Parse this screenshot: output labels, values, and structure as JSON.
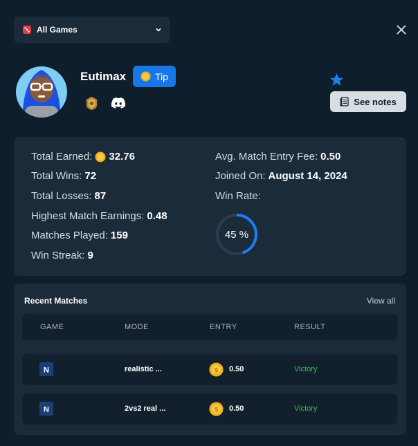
{
  "game_selector": {
    "label": "All Games"
  },
  "profile": {
    "username": "Eutimax",
    "tip_label": "Tip",
    "notes_label": "See notes"
  },
  "stats": {
    "total_earned_label": "Total Earned:",
    "total_earned_value": "32.76",
    "total_wins_label": "Total Wins:",
    "total_wins_value": "72",
    "total_losses_label": "Total Losses:",
    "total_losses_value": "87",
    "highest_label": "Highest Match Earnings:",
    "highest_value": "0.48",
    "played_label": "Matches Played:",
    "played_value": "159",
    "streak_label": "Win Streak:",
    "streak_value": "9",
    "entry_fee_label": "Avg. Match Entry Fee:",
    "entry_fee_value": "0.50",
    "joined_label": "Joined On:",
    "joined_value": "August 14, 2024",
    "win_rate_label": "Win Rate:",
    "win_rate_text": "45 %",
    "win_rate_fraction": 0.45
  },
  "recent_matches": {
    "title": "Recent Matches",
    "view_all": "View all",
    "columns": {
      "game": "GAME",
      "mode": "MODE",
      "entry": "ENTRY",
      "result": "RESULT"
    },
    "rows": [
      {
        "mode": "realistic ...",
        "entry": "0.50",
        "result": "Victory"
      },
      {
        "mode": "2vs2 real ...",
        "entry": "0.50",
        "result": "Victory"
      }
    ]
  },
  "colors": {
    "background": "#0f1e2c",
    "card": "#1b2b3a",
    "accent_blue": "#1877e6",
    "victory_green": "#3fb950",
    "coin_gold": "#f2b21b"
  },
  "icons": [
    "dice-icon",
    "chevron-down-icon",
    "close-icon",
    "coin-icon",
    "rank-badge-icon",
    "discord-icon",
    "star-icon",
    "notes-icon",
    "game-logo-icon"
  ]
}
